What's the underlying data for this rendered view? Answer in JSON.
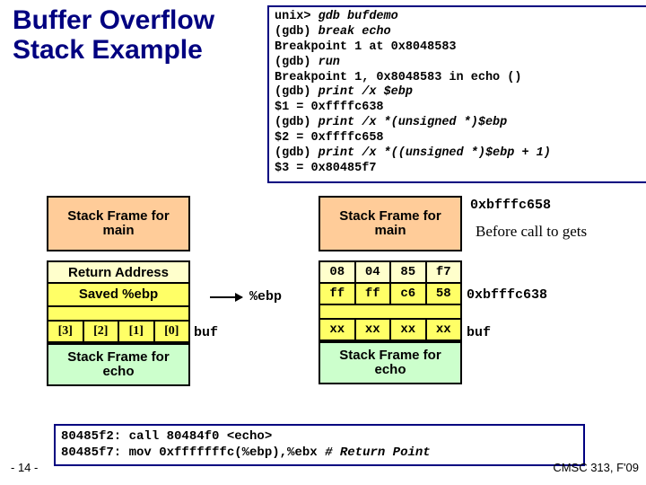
{
  "title": "Buffer Overflow Stack Example",
  "gdb": {
    "l1a": "unix> ",
    "l1b": "gdb bufdemo",
    "l2a": "(gdb) ",
    "l2b": "break echo",
    "l3": "Breakpoint 1 at 0x8048583",
    "l4a": "(gdb) ",
    "l4b": "run",
    "l5": "Breakpoint 1, 0x8048583 in echo ()",
    "l6a": "(gdb) ",
    "l6b": "print /x $ebp",
    "l7": "$1 = 0xffffc638",
    "l8a": "(gdb) ",
    "l8b": "print /x *(unsigned *)$ebp",
    "l9": "$2 = 0xffffc658",
    "l10a": "(gdb) ",
    "l10b": "print /x *((unsigned *)$ebp + 1)",
    "l11": "$3 = 0x80485f7"
  },
  "leftStack": {
    "main": "Stack Frame for main",
    "ret": "Return Address",
    "saved": "Saved %ebp",
    "idx": [
      "[3]",
      "[2]",
      "[1]",
      "[0]"
    ],
    "echo": "Stack Frame for echo"
  },
  "rightStack": {
    "main": "Stack Frame for main",
    "ret": [
      "08",
      "04",
      "85",
      "f7"
    ],
    "ebp": [
      "ff",
      "ff",
      "c6",
      "58"
    ],
    "buf": [
      "xx",
      "xx",
      "xx",
      "xx"
    ],
    "echo": "Stack Frame for echo"
  },
  "labels": {
    "ebp_ptr": "%ebp",
    "buf_ptr": "buf",
    "addr_main": "0xbfffc658",
    "before": "Before call to gets",
    "addr_ebp": "0xbfffc638",
    "buf_r": "buf"
  },
  "asm": {
    "l1": "80485f2: call 80484f0 <echo>",
    "l2a": "80485f7: mov  0xfffffffc(%ebp),%ebx ",
    "l2b": "# Return Point"
  },
  "pagenum": "- 14 -",
  "course": "CMSC 313, F'09"
}
